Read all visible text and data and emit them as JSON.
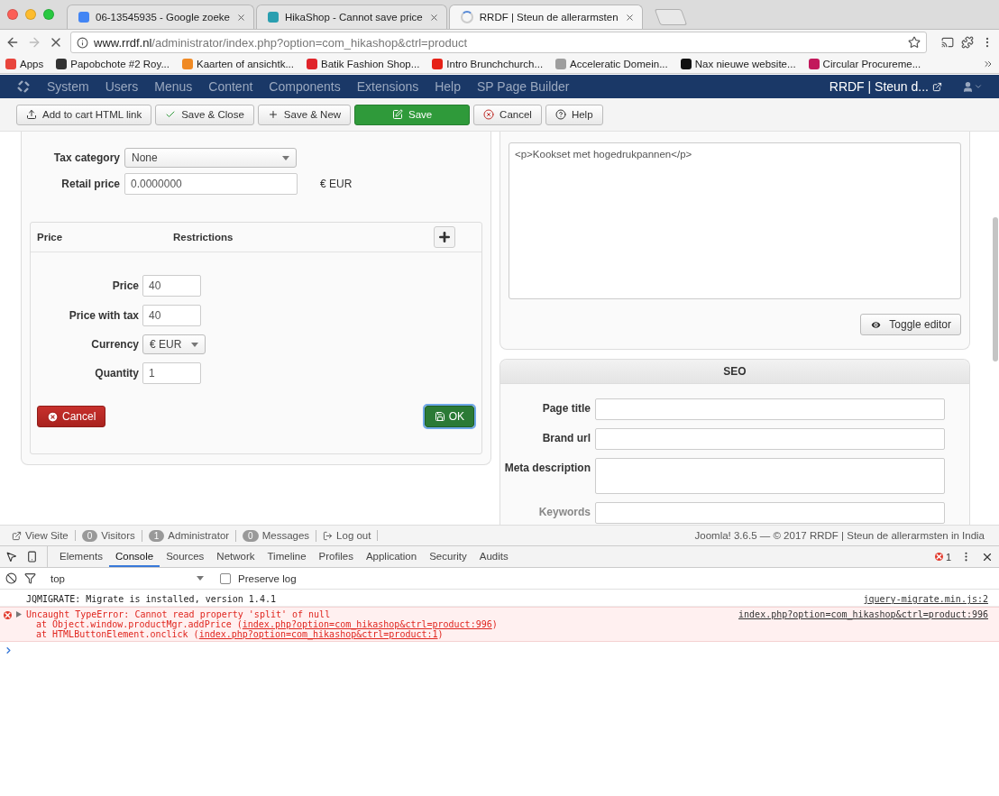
{
  "browser": {
    "tabs": [
      {
        "title": "06-13545935 - Google zoeke",
        "kind": "page",
        "color": "#4285f4",
        "selected": false
      },
      {
        "title": "HikaShop - Cannot save price",
        "kind": "page",
        "color": "#2a9fb0",
        "selected": false
      },
      {
        "title": "RRDF | Steun de allerarmsten",
        "kind": "loading",
        "selected": true
      }
    ],
    "url": {
      "host": "www.rrdf.nl",
      "path": "/administrator/index.php?option=com_hikashop&ctrl=product"
    },
    "bookmarks": [
      {
        "label": "Apps",
        "color": "#e8453c"
      },
      {
        "label": "Papobchote #2 Roy...",
        "color": "#333333"
      },
      {
        "label": "Kaarten of ansichtk...",
        "color": "#f08a24"
      },
      {
        "label": "Batik Fashion Shop...",
        "color": "#e0242a"
      },
      {
        "label": "Intro Brunchchurch...",
        "color": "#e62117"
      },
      {
        "label": "Acceleratic Domein...",
        "color": "#9e9e9e"
      },
      {
        "label": "Nax nieuwe website...",
        "color": "#111111"
      },
      {
        "label": "Circular Procureme...",
        "color": "#c2185b"
      }
    ]
  },
  "admin_menu": {
    "items": [
      "System",
      "Users",
      "Menus",
      "Content",
      "Components",
      "Extensions",
      "Help",
      "SP Page Builder"
    ],
    "site_title": "RRDF | Steun d..."
  },
  "toolbar": [
    {
      "label": "Add to cart HTML link",
      "kind": "default"
    },
    {
      "label": "Save & Close",
      "kind": "default"
    },
    {
      "label": "Save & New",
      "kind": "default"
    },
    {
      "label": "Save",
      "kind": "primary"
    },
    {
      "label": "Cancel",
      "kind": "default"
    },
    {
      "label": "Help",
      "kind": "default"
    }
  ],
  "pricing": {
    "tax_category": {
      "label": "Tax category",
      "value": "None"
    },
    "retail_price": {
      "label": "Retail price",
      "value": "0.0000000",
      "currency": "€ EUR"
    },
    "price_table": {
      "columns": [
        "Price",
        "Restrictions"
      ],
      "fields": [
        {
          "label": "Price",
          "kind": "input",
          "value": "40"
        },
        {
          "label": "Price with tax",
          "kind": "input",
          "value": "40"
        },
        {
          "label": "Currency",
          "kind": "select",
          "value": "€ EUR"
        },
        {
          "label": "Quantity",
          "kind": "input",
          "value": "1"
        }
      ],
      "cancel": "Cancel",
      "ok": "OK"
    }
  },
  "description": {
    "value": "<p>Kookset met hogedrukpannen</p>",
    "toggle": "Toggle editor"
  },
  "seo": {
    "title": "SEO",
    "fields": [
      {
        "label": "Page title",
        "kind": "input"
      },
      {
        "label": "Brand url",
        "kind": "input"
      },
      {
        "label": "Meta description",
        "kind": "textarea"
      },
      {
        "label": "Keywords",
        "kind": "input"
      }
    ]
  },
  "status_bar": {
    "items": [
      {
        "kind": "link",
        "label": "View Site"
      },
      {
        "kind": "count",
        "count": "0",
        "label": "Visitors"
      },
      {
        "kind": "count",
        "count": "1",
        "label": "Administrator"
      },
      {
        "kind": "count",
        "count": "0",
        "label": "Messages"
      },
      {
        "kind": "logout",
        "label": "Log out"
      }
    ],
    "footer": "Joomla! 3.6.5  —  © 2017 RRDF | Steun de allerarmsten in India"
  },
  "devtools": {
    "tabs": [
      {
        "label": "Elements",
        "selected": false
      },
      {
        "label": "Console",
        "selected": true
      },
      {
        "label": "Sources",
        "selected": false
      },
      {
        "label": "Network",
        "selected": false
      },
      {
        "label": "Timeline",
        "selected": false
      },
      {
        "label": "Profiles",
        "selected": false
      },
      {
        "label": "Application",
        "selected": false
      },
      {
        "label": "Security",
        "selected": false
      },
      {
        "label": "Audits",
        "selected": false
      }
    ],
    "error_count": "1",
    "context": "top",
    "preserve_log": {
      "label": "Preserve log",
      "checked": false
    },
    "messages": [
      {
        "kind": "log",
        "text": "JQMIGRATE: Migrate is installed, version 1.4.1",
        "source": "jquery-migrate.min.js:2"
      },
      {
        "kind": "error",
        "text": "Uncaught TypeError: Cannot read property 'split' of null",
        "source": "index.php?option=com_hikashop&ctrl=product:996",
        "stack": [
          {
            "prefix": "at Object.window.productMgr.addPrice (",
            "link": "index.php?option=com_hikashop&ctrl=product:996",
            "suffix": ")"
          },
          {
            "prefix": "at HTMLButtonElement.onclick (",
            "link": "index.php?option=com_hikashop&ctrl=product:1",
            "suffix": ")"
          }
        ]
      }
    ]
  }
}
